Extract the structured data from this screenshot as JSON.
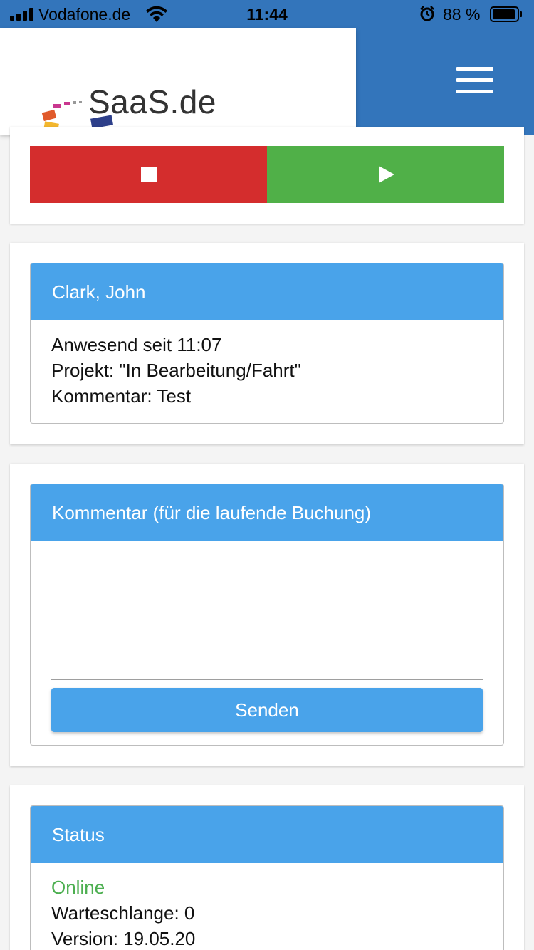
{
  "status_bar": {
    "carrier": "Vodafone.de",
    "time": "11:44",
    "battery_percent": "88 %",
    "icons": [
      "signal-icon",
      "wifi-icon",
      "alarm-icon",
      "battery-icon"
    ]
  },
  "header": {
    "logo_text": "SaaS",
    "logo_suffix": ".de",
    "menu_icon": "hamburger-menu-icon"
  },
  "controls": {
    "stop_icon": "stop-icon",
    "play_icon": "play-icon",
    "stop_color": "#d42d2d",
    "play_color": "#50b048"
  },
  "employee": {
    "name": "Clark, John",
    "present_since": "Anwesend seit 11:07",
    "project": "Projekt: \"In Bearbeitung/Fahrt\"",
    "comment": "Kommentar: Test"
  },
  "comment_panel": {
    "title": "Kommentar (für die laufende Buchung)",
    "value": "",
    "send_label": "Senden"
  },
  "status_panel": {
    "title": "Status",
    "online": "Online",
    "queue": "Warteschlange: 0",
    "version": "Version: 19.05.20"
  },
  "colors": {
    "header_blue": "#3375bb",
    "panel_blue": "#49a3ea",
    "online_green": "#4caf50"
  }
}
